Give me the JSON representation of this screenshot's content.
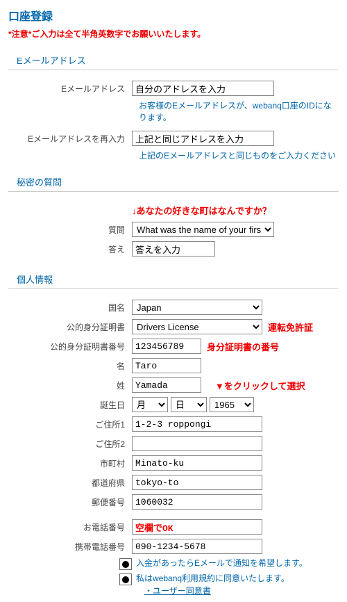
{
  "title": "口座登録",
  "warning": "*注意*ご入力は全て半角英数字でお願いいたします。",
  "sections": {
    "email": "Eメールアドレス",
    "secret": "秘密の質問",
    "personal": "個人情報"
  },
  "email": {
    "label": "Eメールアドレス",
    "value": "自分のアドレスを入力",
    "hint": "お客様のEメールアドレスが、webanq口座のIDになります。",
    "confirm_label": "Eメールアドレスを再入力",
    "confirm_value": "上記と同じアドレスを入力",
    "confirm_hint": "上記のEメールアドレスと同じものをご入力ください"
  },
  "secret": {
    "note": "↓あなたの好きな町はなんですか？",
    "q_label": "質問",
    "q_value": "What was the name of your firs",
    "a_label": "答え",
    "a_value": "答えを入力"
  },
  "personal": {
    "country_label": "国名",
    "country_value": "Japan",
    "id_label": "公的身分証明書",
    "id_value": "Drivers License",
    "id_note": "運転免許証",
    "idnum_label": "公的身分証明書番号",
    "idnum_value": "123456789",
    "idnum_note": "身分証明書の番号",
    "first_label": "名",
    "first_value": "Taro",
    "last_label": "姓",
    "last_value": "Yamada",
    "last_note": "▼をクリックして選択",
    "birth_label": "誕生日",
    "birth_month": "月",
    "birth_day": "日",
    "birth_year": "1965",
    "addr1_label": "ご住所1",
    "addr1_value": "1-2-3 roppongi",
    "addr2_label": "ご住所2",
    "addr2_value": "",
    "city_label": "市町村",
    "city_value": "Minato-ku",
    "pref_label": "都道府県",
    "pref_value": "tokyo-to",
    "zip_label": "郵便番号",
    "zip_value": "1060032",
    "tel_label": "お電話番号",
    "tel_value": "空欄でOK",
    "mobile_label": "携帯電話番号",
    "mobile_value": "090-1234-5678"
  },
  "checks": {
    "notify": "入金があったらEメールで通知を希望します。",
    "agree": "私はwebanq利用規約に同意いたします。",
    "agree_link": "・ユーザー同意書"
  }
}
